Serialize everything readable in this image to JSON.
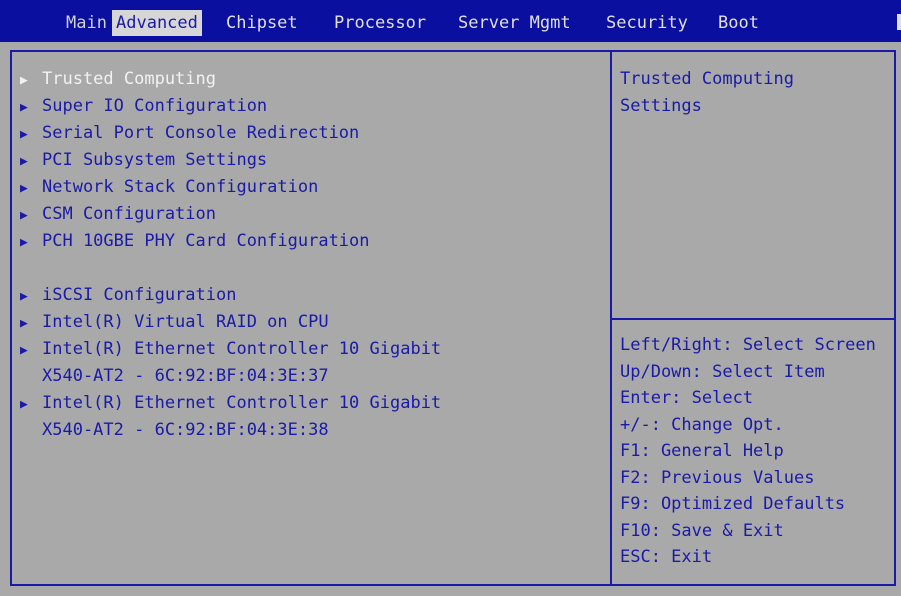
{
  "tabs": [
    {
      "label": "Main"
    },
    {
      "label": "Advanced"
    },
    {
      "label": "Chipset"
    },
    {
      "label": "Processor"
    },
    {
      "label": "Server Mgmt"
    },
    {
      "label": "Security"
    },
    {
      "label": "Boot"
    }
  ],
  "active_tab": "Advanced",
  "menu": {
    "items": [
      {
        "label": "Trusted Computing"
      },
      {
        "label": "Super IO Configuration"
      },
      {
        "label": "Serial Port Console Redirection"
      },
      {
        "label": "PCI Subsystem Settings"
      },
      {
        "label": "Network Stack Configuration"
      },
      {
        "label": "CSM Configuration"
      },
      {
        "label": "PCH 10GBE PHY Card Configuration"
      },
      {
        "label": "iSCSI Configuration"
      },
      {
        "label": "Intel(R) Virtual RAID on CPU"
      },
      {
        "label": "Intel(R) Ethernet Controller 10 Gigabit",
        "sub": "X540-AT2 - 6C:92:BF:04:3E:37"
      },
      {
        "label": "Intel(R) Ethernet Controller 10 Gigabit",
        "sub": "X540-AT2 - 6C:92:BF:04:3E:38"
      }
    ],
    "selected_index": 0
  },
  "help": {
    "lines": [
      "Trusted Computing",
      "Settings"
    ]
  },
  "keys": [
    "Left/Right: Select Screen",
    "Up/Down: Select Item",
    "Enter: Select",
    "+/-: Change Opt.",
    "F1: General Help",
    "F2: Previous Values",
    "F9: Optimized Defaults",
    "F10: Save & Exit",
    "ESC: Exit"
  ],
  "arrow_glyph": "▶",
  "colors": {
    "tabbar_bg": "#0a0fa0",
    "body_bg": "#a9a9a9",
    "text": "#1a1aa8",
    "selected_text": "#f2f2f2",
    "active_tab_bg": "#d6d6d6"
  }
}
